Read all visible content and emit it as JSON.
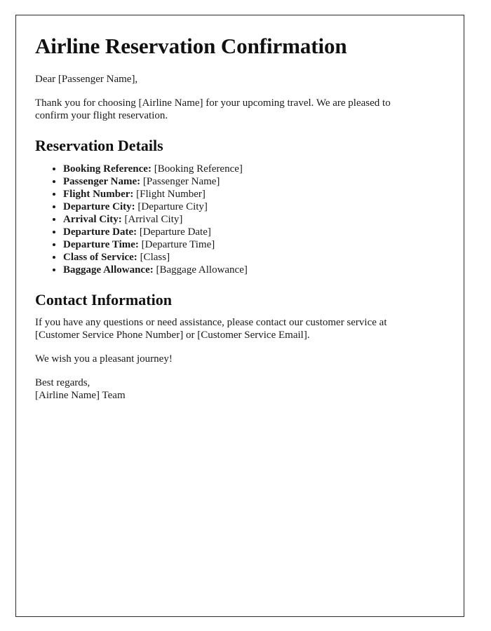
{
  "document": {
    "title": "Airline Reservation Confirmation",
    "salutation": "Dear [Passenger Name],",
    "intro": "Thank you for choosing [Airline Name] for your upcoming travel. We are pleased to confirm your flight reservation.",
    "reservation_section": {
      "heading": "Reservation Details",
      "items": [
        {
          "label": "Booking Reference:",
          "value": "[Booking Reference]"
        },
        {
          "label": "Passenger Name:",
          "value": "[Passenger Name]"
        },
        {
          "label": "Flight Number:",
          "value": "[Flight Number]"
        },
        {
          "label": "Departure City:",
          "value": "[Departure City]"
        },
        {
          "label": "Arrival City:",
          "value": "[Arrival City]"
        },
        {
          "label": "Departure Date:",
          "value": "[Departure Date]"
        },
        {
          "label": "Departure Time:",
          "value": "[Departure Time]"
        },
        {
          "label": "Class of Service:",
          "value": "[Class]"
        },
        {
          "label": "Baggage Allowance:",
          "value": "[Baggage Allowance]"
        }
      ]
    },
    "contact_section": {
      "heading": "Contact Information",
      "body": "If you have any questions or need assistance, please contact our customer service at [Customer Service Phone Number] or [Customer Service Email].",
      "wish": "We wish you a pleasant journey!",
      "signoff_line1": "Best regards,",
      "signoff_line2": "[Airline Name] Team"
    }
  }
}
